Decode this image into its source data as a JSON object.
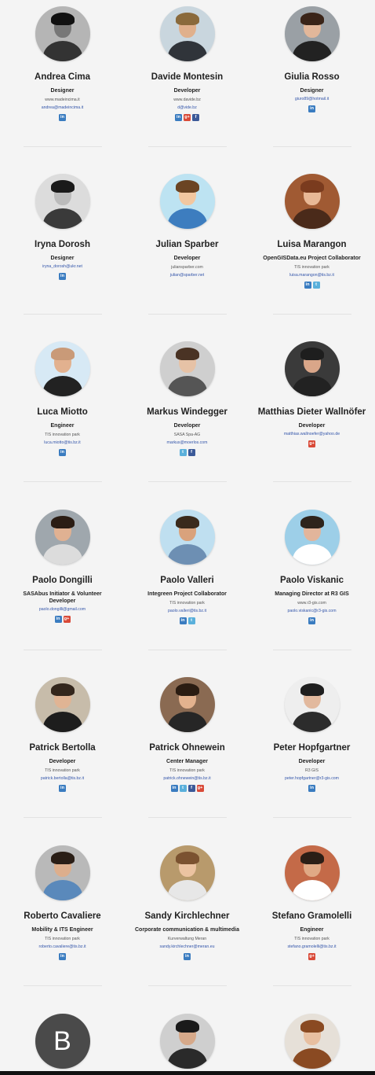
{
  "people": [
    {
      "name": "Andrea Cima",
      "role": "Designer",
      "org": "",
      "website": "www.madeincima.it",
      "email": "andrea@madeincima.it",
      "social": [
        "linkedin"
      ],
      "colors": {
        "bg": "#b5b5b5",
        "skin": "#777777",
        "hair": "#111111",
        "shirt": "#333333"
      }
    },
    {
      "name": "Davide Montesin",
      "role": "Developer",
      "org": "",
      "website": "www.davide.bz",
      "email": "d@vide.bz",
      "social": [
        "linkedin",
        "googleplus",
        "facebook"
      ],
      "colors": {
        "bg": "#c9d6de",
        "skin": "#e0b08c",
        "hair": "#8a6a3c",
        "shirt": "#30343a"
      }
    },
    {
      "name": "Giulia Rosso",
      "role": "Designer",
      "org": "",
      "website": "",
      "email": "giuro89@hotmail.it",
      "social": [
        "linkedin"
      ],
      "colors": {
        "bg": "#9aa0a5",
        "skin": "#e2b79a",
        "hair": "#3a2418",
        "shirt": "#222222"
      }
    },
    {
      "name": "Iryna Dorosh",
      "role": "Designer",
      "org": "",
      "website": "",
      "email": "iryna_dorosh@ukr.net",
      "social": [
        "linkedin"
      ],
      "colors": {
        "bg": "#dcdcdc",
        "skin": "#bbbbbb",
        "hair": "#1a1a1a",
        "shirt": "#3a3a3a"
      }
    },
    {
      "name": "Julian Sparber",
      "role": "Developer",
      "org": "",
      "website": "juliansparber.com",
      "email": "julian@sparber.net",
      "social": [],
      "colors": {
        "bg": "#bde3f2",
        "skin": "#f2c7a0",
        "hair": "#6b4423",
        "shirt": "#3d7dbf"
      }
    },
    {
      "name": "Luisa Marangon",
      "role": "OpenGISData.eu Project Collaborator",
      "org": "TIS innovation park",
      "website": "",
      "email": "luisa.marangon@tis.bz.it",
      "social": [
        "linkedin",
        "twitter"
      ],
      "colors": {
        "bg": "#a05a33",
        "skin": "#e8b896",
        "hair": "#7a3b1e",
        "shirt": "#4a2a1a"
      }
    },
    {
      "name": "Luca Miotto",
      "role": "Engineer",
      "org": "TIS innovation park",
      "website": "",
      "email": "luca.miotto@tis.bz.it",
      "social": [
        "linkedin"
      ],
      "colors": {
        "bg": "#d7e9f5",
        "skin": "#e2b18f",
        "hair": "#c99a78",
        "shirt": "#222222"
      }
    },
    {
      "name": "Markus Windegger",
      "role": "Developer",
      "org": "SASA Spa-AG",
      "website": "",
      "email": "markus@moerlos.com",
      "social": [
        "twitter",
        "facebook"
      ],
      "colors": {
        "bg": "#cfcfcf",
        "skin": "#e6c2a6",
        "hair": "#4a3324",
        "shirt": "#555555"
      }
    },
    {
      "name": "Matthias Dieter Wallnöfer",
      "role": "Developer",
      "org": "",
      "website": "",
      "email": "matthias.wallnoefer@yahoo.de",
      "social": [
        "googleplus"
      ],
      "colors": {
        "bg": "#3a3a3a",
        "skin": "#d9a689",
        "hair": "#1e1e1e",
        "shirt": "#222222"
      }
    },
    {
      "name": "Paolo Dongilli",
      "role": "SASAbus Initiator & Volunteer Developer",
      "org": "",
      "website": "",
      "email": "paolo.dongilli@gmail.com",
      "social": [
        "linkedin",
        "googleplus"
      ],
      "colors": {
        "bg": "#9fa7ad",
        "skin": "#e0b192",
        "hair": "#2b1d14",
        "shirt": "#dcdcdc"
      }
    },
    {
      "name": "Paolo Valleri",
      "role": "Integreen Project Collaborator",
      "org": "TIS innovation park",
      "website": "",
      "email": "paolo.valleri@tis.bz.it",
      "social": [
        "linkedin",
        "twitter"
      ],
      "colors": {
        "bg": "#bfdff0",
        "skin": "#d9a27c",
        "hair": "#3a2a1c",
        "shirt": "#6d8fb3"
      }
    },
    {
      "name": "Paolo Viskanic",
      "role": "Managing Director at R3 GIS",
      "org": "",
      "website": "www.r3-gis.com",
      "email": "paolo.viskanic@r3-gis.com",
      "social": [
        "linkedin"
      ],
      "colors": {
        "bg": "#9dcfe8",
        "skin": "#e2b59b",
        "hair": "#2e241c",
        "shirt": "#ffffff"
      }
    },
    {
      "name": "Patrick Bertolla",
      "role": "Developer",
      "org": "TIS innovation park",
      "website": "",
      "email": "patrick.bertolla@tis.bz.it",
      "social": [
        "linkedin"
      ],
      "colors": {
        "bg": "#c7bcaa",
        "skin": "#e0b494",
        "hair": "#33261c",
        "shirt": "#1d1d1d"
      }
    },
    {
      "name": "Patrick Ohnewein",
      "role": "Center Manager",
      "org": "TIS innovation park",
      "website": "",
      "email": "patrick.ohnewein@tis.bz.it",
      "social": [
        "linkedin",
        "twitter",
        "facebook",
        "googleplus"
      ],
      "colors": {
        "bg": "#8a6a52",
        "skin": "#e3b28e",
        "hair": "#2a1c12",
        "shirt": "#262626"
      }
    },
    {
      "name": "Peter Hopfgartner",
      "role": "Developer",
      "org": "R3 GIS",
      "website": "",
      "email": "peter.hopfgartner@r3-gis.com",
      "social": [
        "linkedin"
      ],
      "colors": {
        "bg": "#eeeeee",
        "skin": "#e2b99e",
        "hair": "#1f1f1f",
        "shirt": "#2c2c2c"
      }
    },
    {
      "name": "Roberto Cavaliere",
      "role": "Mobility & ITS Engineer",
      "org": "TIS innovation park",
      "website": "",
      "email": "roberto.cavaliere@tis.bz.it",
      "social": [
        "linkedin"
      ],
      "colors": {
        "bg": "#b9b9b9",
        "skin": "#ddae8c",
        "hair": "#2a1e16",
        "shirt": "#5a89bb"
      }
    },
    {
      "name": "Sandy Kirchlechner",
      "role": "Corporate communication & multimedia",
      "org": "Kurverwaltung Meran",
      "website": "",
      "email": "sandy.kirchlechner@meran.eu",
      "social": [
        "linkedin"
      ],
      "colors": {
        "bg": "#b89a6c",
        "skin": "#ebc3a1",
        "hair": "#7b5230",
        "shirt": "#e7e7e7"
      }
    },
    {
      "name": "Stefano Gramolelli",
      "role": "Engineer",
      "org": "TIS innovation park",
      "website": "",
      "email": "stefano.gramolelli@tis.bz.it",
      "social": [
        "googleplus"
      ],
      "colors": {
        "bg": "#c46a48",
        "skin": "#e0a985",
        "hair": "#2b1e16",
        "shirt": "#ffffff"
      }
    },
    {
      "name": "",
      "role": "",
      "org": "",
      "website": "",
      "email": "",
      "social": [],
      "colors": {
        "bg": "#4a4a4a",
        "skin": "#4a4a4a",
        "hair": "#4a4a4a",
        "shirt": "#4a4a4a"
      },
      "letter": "B"
    },
    {
      "name": "",
      "role": "",
      "org": "",
      "website": "",
      "email": "",
      "social": [],
      "colors": {
        "bg": "#cfcfcf",
        "skin": "#d6a98a",
        "hair": "#1a1a1a",
        "shirt": "#2a2a2a"
      }
    },
    {
      "name": "",
      "role": "",
      "org": "",
      "website": "",
      "email": "",
      "social": [],
      "colors": {
        "bg": "#e6e0d8",
        "skin": "#e8bfa0",
        "hair": "#8a4a22",
        "shirt": "#8a4a22"
      }
    }
  ],
  "social_labels": {
    "linkedin": "in",
    "twitter": "t",
    "facebook": "f",
    "googleplus": "g+"
  },
  "social_icons": {
    "linkedin": "linkedin-icon",
    "twitter": "twitter-icon",
    "facebook": "facebook-icon",
    "googleplus": "google-plus-icon"
  }
}
